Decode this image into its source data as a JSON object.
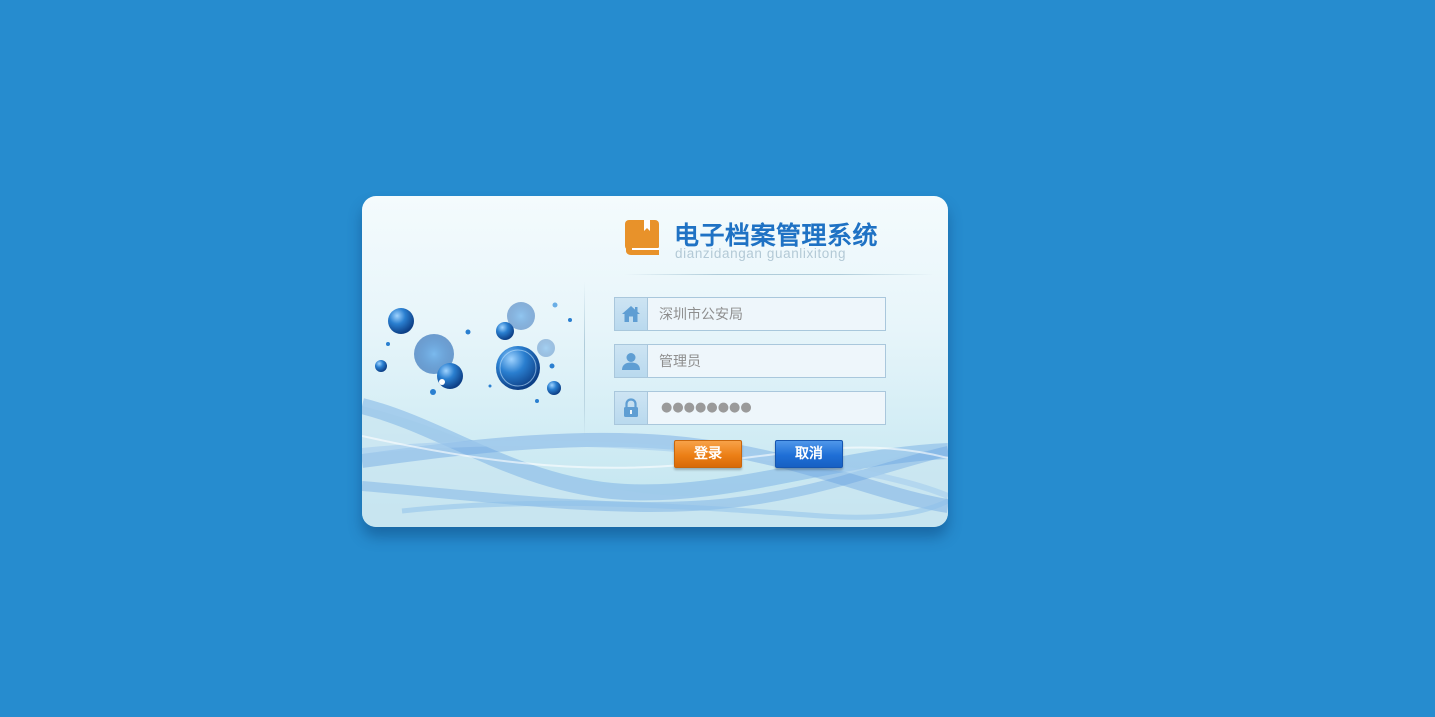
{
  "app": {
    "title": "电子档案管理系统",
    "subtitle": "dianzidangan guanlixitong"
  },
  "form": {
    "unit_field": {
      "value": "深圳市公安局",
      "icon": "home-icon"
    },
    "user_field": {
      "value": "管理员",
      "icon": "user-icon"
    },
    "password_field": {
      "masked_value": "●●●●●●●●",
      "icon": "lock-icon"
    }
  },
  "buttons": {
    "login_label": "登录",
    "cancel_label": "取消"
  },
  "colors": {
    "background": "#268ccf",
    "title": "#1f72c4",
    "login_button": "#ec7f16",
    "cancel_button": "#1f6fd6",
    "logo": "#e8922a"
  }
}
